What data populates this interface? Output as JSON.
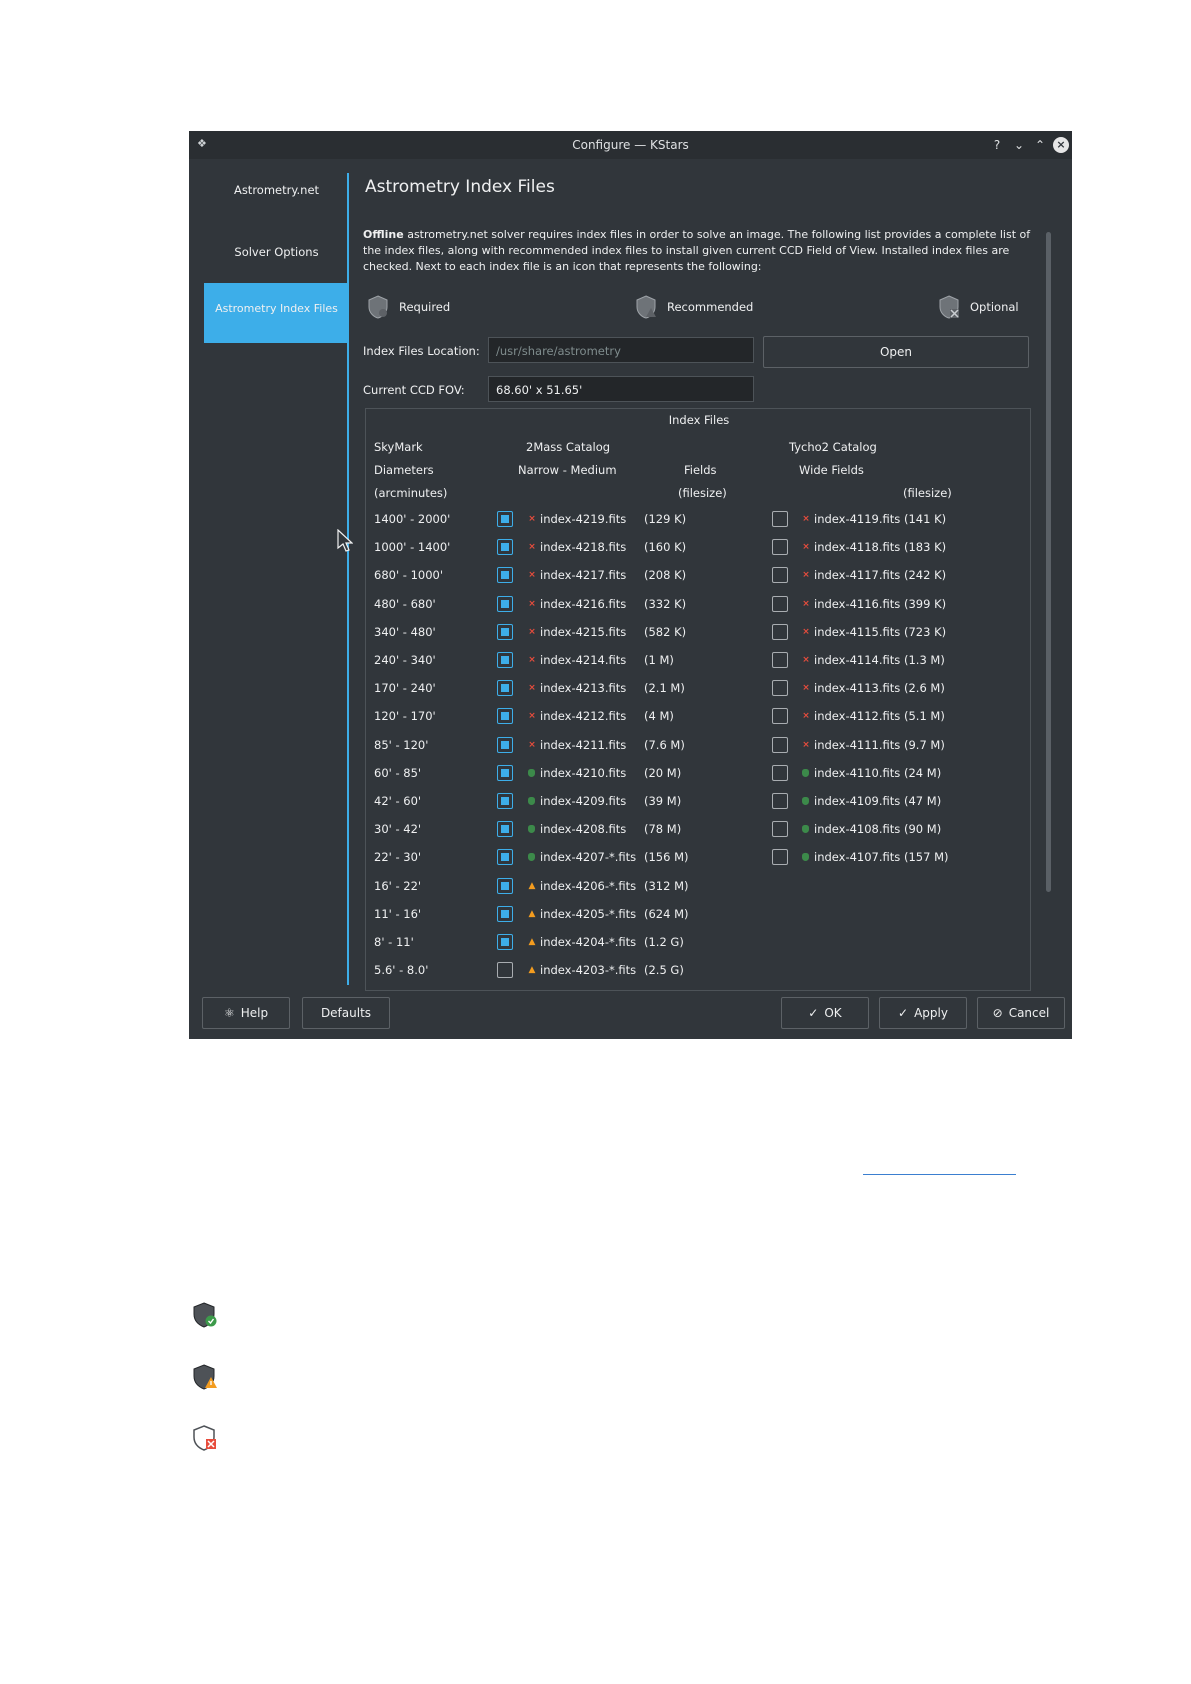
{
  "window": {
    "title": "Configure — KStars",
    "help_icon": "question-icon",
    "minimize_icon": "chevron-down-icon",
    "maximize_icon": "chevron-up-icon",
    "close_icon": "close-icon"
  },
  "nav": {
    "items": [
      {
        "label": "Astrometry.net"
      },
      {
        "label": "Solver Options"
      },
      {
        "label": "Astrometry Index Files"
      }
    ],
    "active_index": 2
  },
  "page": {
    "heading": "Astrometry Index Files",
    "desc_bold": "Offline",
    "desc_rest": " astrometry.net solver requires index files in order to solve an image. The following list provides a complete list of the index files, along with recommended index files to install given current CCD Field of View. Installed index files are checked. Next to each index file is an icon that represents the following:",
    "legend": {
      "required": "Required",
      "recommended": "Recommended",
      "optional": "Optional"
    },
    "location_label": "Index Files Location:",
    "location_placeholder": "/usr/share/astrometry",
    "open_label": "Open",
    "fov_label": "Current CCD FOV:",
    "fov_value": "68.60' x 51.65'"
  },
  "table": {
    "group_title": "Index Files",
    "col1": [
      "SkyMark",
      "Diameters",
      "(arcminutes)"
    ],
    "col2": [
      "2Mass Catalog",
      "Narrow - Medium"
    ],
    "col3": [
      "Fields",
      "(filesize)"
    ],
    "col4": [
      "Tycho2 Catalog",
      "Wide Fields"
    ],
    "col5": "(filesize)",
    "rows": [
      {
        "range": "1400' - 2000'",
        "n_checked": true,
        "n_icon": "optional",
        "n_file": "index-4219.fits",
        "n_size": "(129 K)",
        "w_checked": false,
        "w_icon": "optional",
        "w_file": "index-4119.fits",
        "w_size": "(141 K)"
      },
      {
        "range": "1000' - 1400'",
        "n_checked": true,
        "n_icon": "optional",
        "n_file": "index-4218.fits",
        "n_size": "(160 K)",
        "w_checked": false,
        "w_icon": "optional",
        "w_file": "index-4118.fits",
        "w_size": "(183 K)"
      },
      {
        "range": "680' - 1000'",
        "n_checked": true,
        "n_icon": "optional",
        "n_file": "index-4217.fits",
        "n_size": "(208 K)",
        "w_checked": false,
        "w_icon": "optional",
        "w_file": "index-4117.fits",
        "w_size": "(242 K)"
      },
      {
        "range": "480' - 680'",
        "n_checked": true,
        "n_icon": "optional",
        "n_file": "index-4216.fits",
        "n_size": "(332 K)",
        "w_checked": false,
        "w_icon": "optional",
        "w_file": "index-4116.fits",
        "w_size": "(399 K)"
      },
      {
        "range": "340' - 480'",
        "n_checked": true,
        "n_icon": "optional",
        "n_file": "index-4215.fits",
        "n_size": "(582 K)",
        "w_checked": false,
        "w_icon": "optional",
        "w_file": "index-4115.fits",
        "w_size": "(723 K)"
      },
      {
        "range": "240' - 340'",
        "n_checked": true,
        "n_icon": "optional",
        "n_file": "index-4214.fits",
        "n_size": "(1 M)",
        "w_checked": false,
        "w_icon": "optional",
        "w_file": "index-4114.fits",
        "w_size": "(1.3 M)"
      },
      {
        "range": "170' - 240'",
        "n_checked": true,
        "n_icon": "optional",
        "n_file": "index-4213.fits",
        "n_size": "(2.1 M)",
        "w_checked": false,
        "w_icon": "optional",
        "w_file": "index-4113.fits",
        "w_size": "(2.6 M)"
      },
      {
        "range": "120' - 170'",
        "n_checked": true,
        "n_icon": "optional",
        "n_file": "index-4212.fits",
        "n_size": "(4 M)",
        "w_checked": false,
        "w_icon": "optional",
        "w_file": "index-4112.fits",
        "w_size": "(5.1 M)"
      },
      {
        "range": "85' - 120'",
        "n_checked": true,
        "n_icon": "optional",
        "n_file": "index-4211.fits",
        "n_size": "(7.6 M)",
        "w_checked": false,
        "w_icon": "optional",
        "w_file": "index-4111.fits",
        "w_size": "(9.7 M)"
      },
      {
        "range": "60' - 85'",
        "n_checked": true,
        "n_icon": "required",
        "n_file": "index-4210.fits",
        "n_size": "(20 M)",
        "w_checked": false,
        "w_icon": "required",
        "w_file": "index-4110.fits",
        "w_size": "(24 M)"
      },
      {
        "range": "42' - 60'",
        "n_checked": true,
        "n_icon": "required",
        "n_file": "index-4209.fits",
        "n_size": "(39 M)",
        "w_checked": false,
        "w_icon": "required",
        "w_file": "index-4109.fits",
        "w_size": "(47 M)"
      },
      {
        "range": "30' - 42'",
        "n_checked": true,
        "n_icon": "required",
        "n_file": "index-4208.fits",
        "n_size": "(78 M)",
        "w_checked": false,
        "w_icon": "required",
        "w_file": "index-4108.fits",
        "w_size": "(90 M)"
      },
      {
        "range": "22' - 30'",
        "n_checked": true,
        "n_icon": "required",
        "n_file": "index-4207-*.fits",
        "n_size": "(156 M)",
        "w_checked": false,
        "w_icon": "required",
        "w_file": "index-4107.fits",
        "w_size": "(157 M)"
      },
      {
        "range": "16' - 22'",
        "n_checked": true,
        "n_icon": "recommended",
        "n_file": "index-4206-*.fits",
        "n_size": "(312 M)"
      },
      {
        "range": "11' - 16'",
        "n_checked": true,
        "n_icon": "recommended",
        "n_file": "index-4205-*.fits",
        "n_size": "(624 M)"
      },
      {
        "range": "8' - 11'",
        "n_checked": true,
        "n_icon": "recommended",
        "n_file": "index-4204-*.fits",
        "n_size": "(1.2 G)"
      },
      {
        "range": "5.6' - 8.0'",
        "n_checked": false,
        "n_icon": "recommended",
        "n_file": "index-4203-*.fits",
        "n_size": "(2.5 G)"
      }
    ]
  },
  "buttons": {
    "help": "Help",
    "defaults": "Defaults",
    "ok": "OK",
    "apply": "Apply",
    "cancel": "Cancel"
  },
  "colors": {
    "accent": "#3daee9",
    "window_bg": "#31363b",
    "required_green": "#3c8a4a",
    "recommended_orange": "#f39c1f",
    "optional_red": "#e74c3c"
  }
}
